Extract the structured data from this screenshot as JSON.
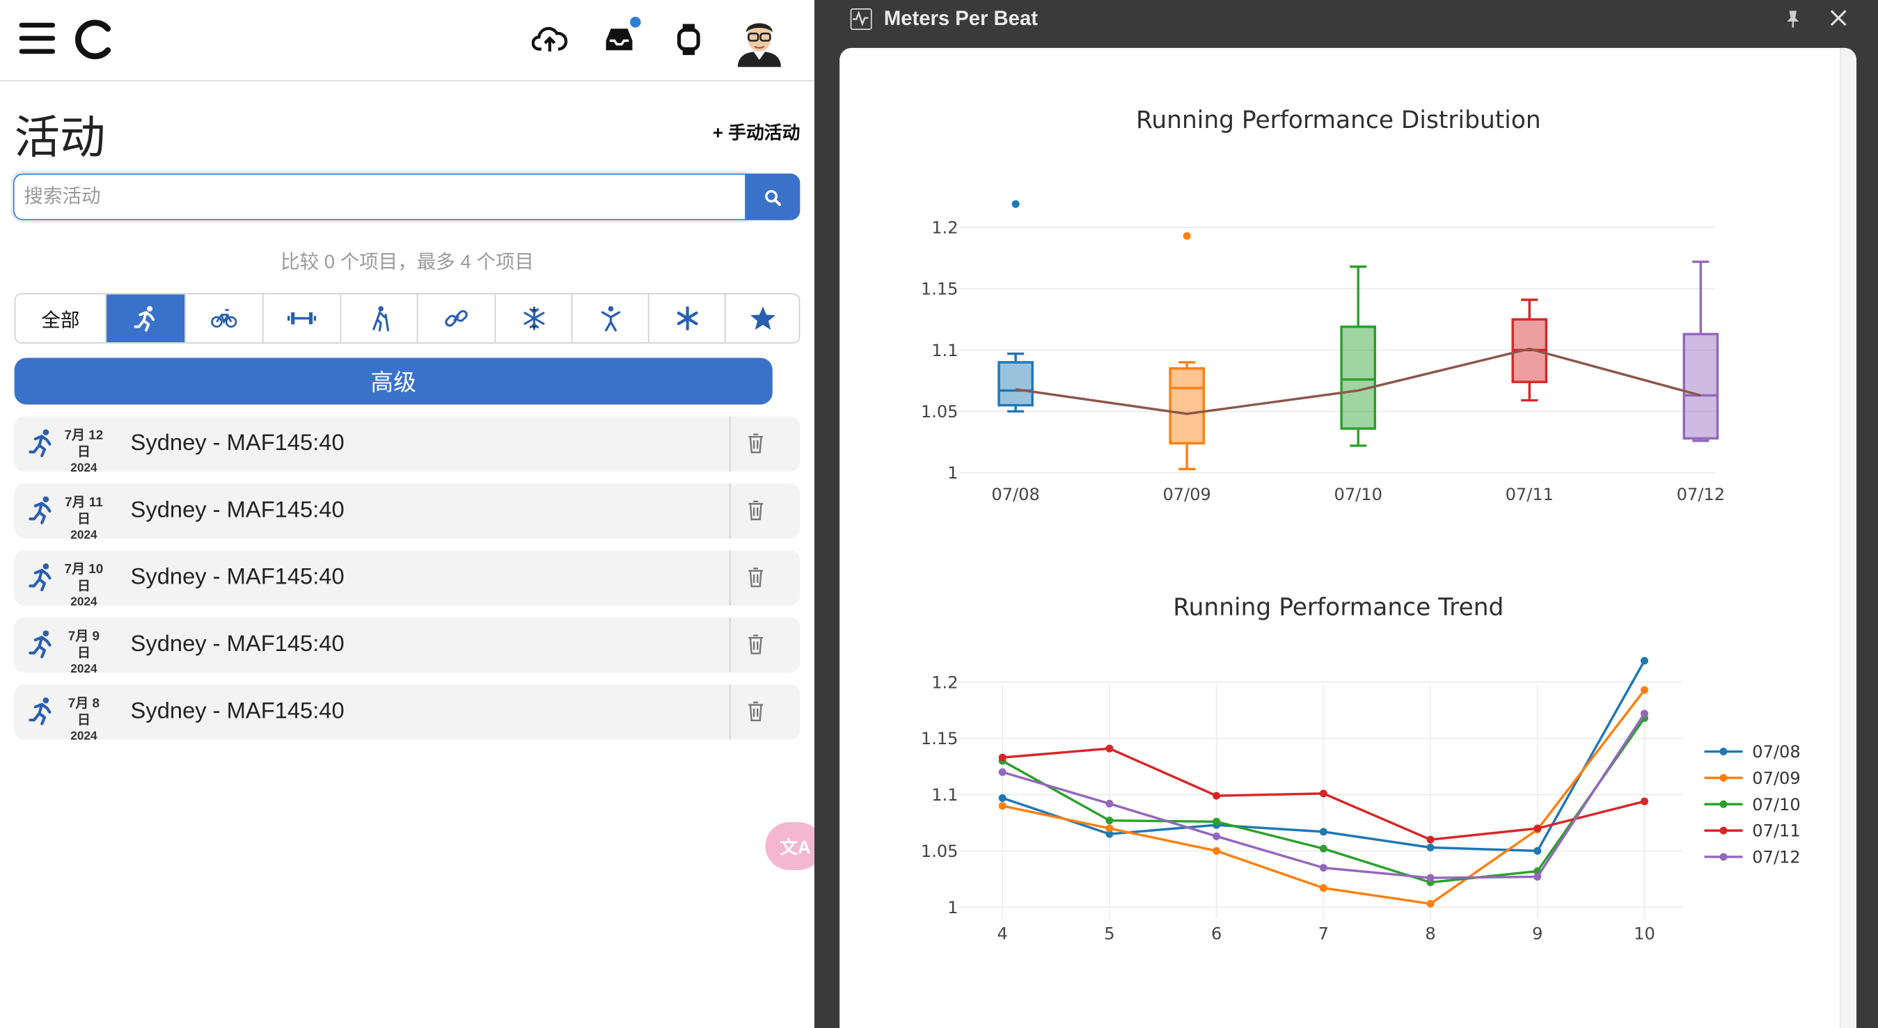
{
  "app": {
    "page_title": "活动",
    "manual_activity_label": "+ 手动活动",
    "search": {
      "placeholder": "搜索活动",
      "value": ""
    },
    "compare_text": "比较 0 个项目，最多 4 个项目",
    "filters": [
      {
        "label": "全部",
        "icon": "",
        "active": false
      },
      {
        "label": "",
        "icon": "running-icon",
        "active": true
      },
      {
        "label": "",
        "icon": "cycling-icon",
        "active": false
      },
      {
        "label": "",
        "icon": "strength-icon",
        "active": false
      },
      {
        "label": "",
        "icon": "hiking-icon",
        "active": false
      },
      {
        "label": "",
        "icon": "multisport-link-icon",
        "active": false
      },
      {
        "label": "",
        "icon": "snowflake-icon",
        "active": false
      },
      {
        "label": "",
        "icon": "yoga-icon",
        "active": false
      },
      {
        "label": "",
        "icon": "asterisk-icon",
        "active": false
      },
      {
        "label": "",
        "icon": "star-icon",
        "active": false
      }
    ],
    "advanced_label": "高级",
    "activities": [
      {
        "date": "7月 12日",
        "year": "2024",
        "title": "Sydney - MAF145:40"
      },
      {
        "date": "7月 11日",
        "year": "2024",
        "title": "Sydney - MAF145:40"
      },
      {
        "date": "7月 10日",
        "year": "2024",
        "title": "Sydney - MAF145:40"
      },
      {
        "date": "7月 9日",
        "year": "2024",
        "title": "Sydney - MAF145:40"
      },
      {
        "date": "7月 8日",
        "year": "2024",
        "title": "Sydney - MAF145:40"
      }
    ],
    "translate_label": "文A"
  },
  "panel": {
    "title": "Meters Per Beat"
  },
  "colors": {
    "accent": "#3a72c9",
    "series": [
      "#1f77b4",
      "#ff7f0e",
      "#2ca02c",
      "#d62728",
      "#9467bd"
    ],
    "median_line": "#8c564b"
  },
  "chart_data": [
    {
      "type": "box",
      "title": "Running Performance Distribution",
      "categories": [
        "07/08",
        "07/09",
        "07/10",
        "07/11",
        "07/12"
      ],
      "ylim": [
        1,
        1.2
      ],
      "yticks": [
        1,
        1.05,
        1.1,
        1.15,
        1.2
      ],
      "series": [
        {
          "name": "07/08",
          "min": 1.05,
          "q1": 1.055,
          "median": 1.067,
          "q3": 1.09,
          "max": 1.097,
          "outliers": [
            1.219
          ],
          "mean": 1.068
        },
        {
          "name": "07/09",
          "min": 1.003,
          "q1": 1.024,
          "median": 1.069,
          "q3": 1.085,
          "max": 1.09,
          "outliers": [
            1.193
          ],
          "mean": 1.048
        },
        {
          "name": "07/10",
          "min": 1.022,
          "q1": 1.036,
          "median": 1.076,
          "q3": 1.119,
          "max": 1.168,
          "outliers": [],
          "mean": 1.067
        },
        {
          "name": "07/11",
          "min": 1.059,
          "q1": 1.074,
          "median": 1.1,
          "q3": 1.125,
          "max": 1.141,
          "outliers": [],
          "mean": 1.101
        },
        {
          "name": "07/12",
          "min": 1.026,
          "q1": 1.028,
          "median": 1.063,
          "q3": 1.113,
          "max": 1.172,
          "outliers": [],
          "mean": 1.063
        }
      ]
    },
    {
      "type": "line",
      "title": "Running Performance Trend",
      "x": [
        4,
        5,
        6,
        7,
        8,
        9,
        10
      ],
      "ylim": [
        1,
        1.2
      ],
      "yticks": [
        1,
        1.05,
        1.1,
        1.15,
        1.2
      ],
      "legend_placement": "right",
      "series": [
        {
          "name": "07/08",
          "values": [
            1.097,
            1.065,
            1.073,
            1.067,
            1.053,
            1.05,
            1.219
          ]
        },
        {
          "name": "07/09",
          "values": [
            1.09,
            1.07,
            1.05,
            1.017,
            1.003,
            1.069,
            1.193
          ]
        },
        {
          "name": "07/10",
          "values": [
            1.13,
            1.077,
            1.076,
            1.052,
            1.022,
            1.032,
            1.168
          ]
        },
        {
          "name": "07/11",
          "values": [
            1.133,
            1.141,
            1.099,
            1.101,
            1.06,
            1.07,
            1.094
          ]
        },
        {
          "name": "07/12",
          "values": [
            1.12,
            1.092,
            1.063,
            1.035,
            1.026,
            1.027,
            1.172
          ]
        }
      ]
    }
  ]
}
